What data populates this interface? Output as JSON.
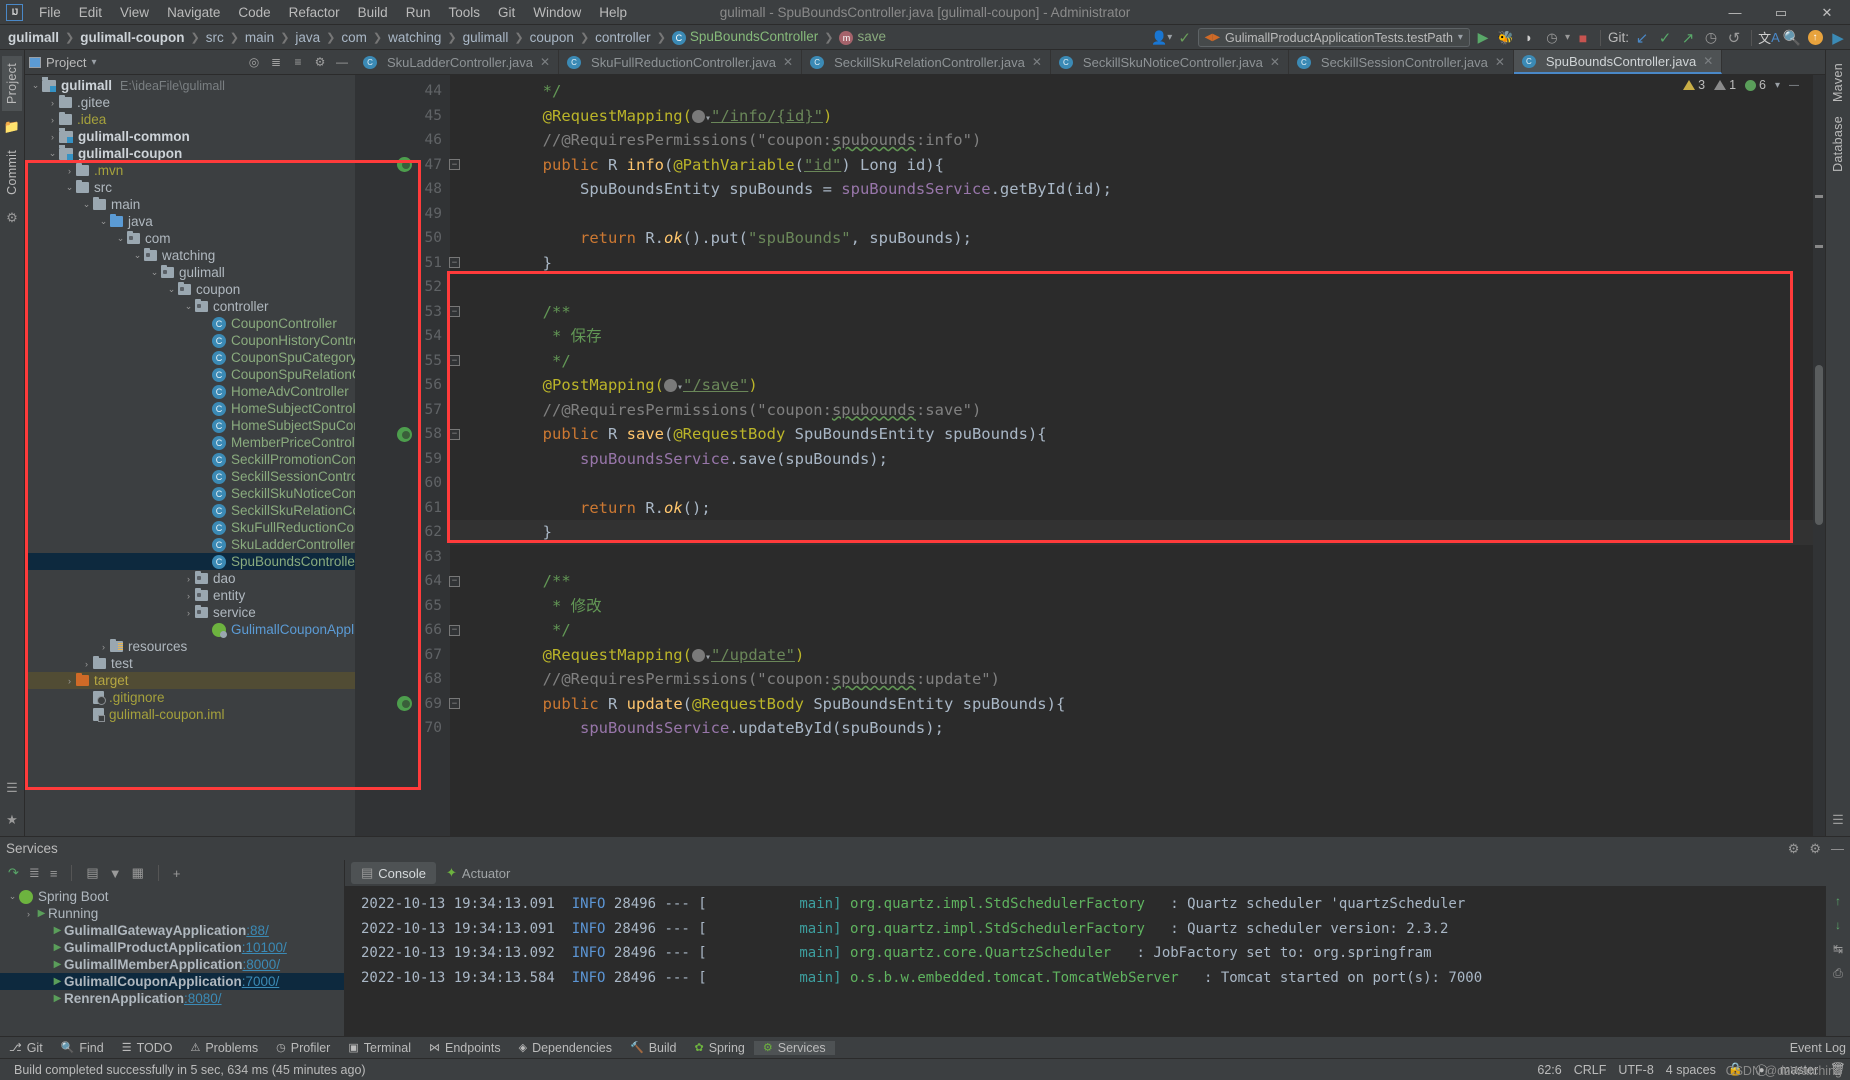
{
  "window": {
    "title": "gulimall - SpuBoundsController.java [gulimall-coupon] - Administrator",
    "minimize": "—",
    "maximize": "▭",
    "close": "✕"
  },
  "menu": [
    "File",
    "Edit",
    "View",
    "Navigate",
    "Code",
    "Refactor",
    "Build",
    "Run",
    "Tools",
    "Git",
    "Window",
    "Help"
  ],
  "breadcrumbs": [
    "gulimall",
    "gulimall-coupon",
    "src",
    "main",
    "java",
    "com",
    "watching",
    "gulimall",
    "coupon",
    "controller",
    "SpuBoundsController",
    "save"
  ],
  "toolbar": {
    "run_config": "GulimallProductApplicationTests.testPath",
    "git_label": "Git:",
    "icons": [
      "profile-icon",
      "hammer-icon",
      "run-icon",
      "debug-icon",
      "run-coverage-icon",
      "profiler-icon",
      "stop-icon",
      "git-update-icon",
      "git-commit-icon",
      "git-push-icon",
      "git-history-icon",
      "git-rollback-icon",
      "translate-icon",
      "search-everywhere-icon",
      "update-icon",
      "ide-icon"
    ]
  },
  "left_strip": {
    "tabs": [
      "Project",
      "Commit"
    ],
    "icons": [
      "folder-icon",
      "commit-icon"
    ]
  },
  "right_strip": {
    "tabs": [
      "Maven",
      "Database"
    ],
    "icons": [
      "notification-icon"
    ]
  },
  "project_panel": {
    "title": "Project",
    "header_icons": [
      "locate-icon",
      "expand-all-icon",
      "collapse-all-icon",
      "gear-icon",
      "hide-icon"
    ],
    "tree": [
      {
        "indent": 0,
        "arrow": "⌄",
        "icon": "module",
        "label": "gulimall",
        "style": "b",
        "path": "E:\\ideaFile\\gulimall"
      },
      {
        "indent": 1,
        "arrow": "›",
        "icon": "folder",
        "label": ".gitee",
        "style": ""
      },
      {
        "indent": 1,
        "arrow": "›",
        "icon": "folder",
        "label": ".idea",
        "style": "olive"
      },
      {
        "indent": 1,
        "arrow": "›",
        "icon": "module",
        "label": "gulimall-common",
        "style": "b"
      },
      {
        "indent": 1,
        "arrow": "⌄",
        "icon": "module",
        "label": "gulimall-coupon",
        "style": "b"
      },
      {
        "indent": 2,
        "arrow": "›",
        "icon": "folder",
        "label": ".mvn",
        "style": "olive"
      },
      {
        "indent": 2,
        "arrow": "⌄",
        "icon": "folder",
        "label": "src",
        "style": ""
      },
      {
        "indent": 3,
        "arrow": "⌄",
        "icon": "folder",
        "label": "main",
        "style": ""
      },
      {
        "indent": 4,
        "arrow": "⌄",
        "icon": "src",
        "label": "java",
        "style": ""
      },
      {
        "indent": 5,
        "arrow": "⌄",
        "icon": "pkg",
        "label": "com",
        "style": ""
      },
      {
        "indent": 6,
        "arrow": "⌄",
        "icon": "pkg",
        "label": "watching",
        "style": ""
      },
      {
        "indent": 7,
        "arrow": "⌄",
        "icon": "pkg",
        "label": "gulimall",
        "style": ""
      },
      {
        "indent": 8,
        "arrow": "⌄",
        "icon": "pkg",
        "label": "coupon",
        "style": ""
      },
      {
        "indent": 9,
        "arrow": "⌄",
        "icon": "pkg",
        "label": "controller",
        "style": ""
      },
      {
        "indent": 10,
        "arrow": "",
        "icon": "class",
        "label": "CouponController",
        "style": "green"
      },
      {
        "indent": 10,
        "arrow": "",
        "icon": "class",
        "label": "CouponHistoryController",
        "style": "green"
      },
      {
        "indent": 10,
        "arrow": "",
        "icon": "class",
        "label": "CouponSpuCategoryRelationC",
        "style": "green"
      },
      {
        "indent": 10,
        "arrow": "",
        "icon": "class",
        "label": "CouponSpuRelationController",
        "style": "green"
      },
      {
        "indent": 10,
        "arrow": "",
        "icon": "class",
        "label": "HomeAdvController",
        "style": "green"
      },
      {
        "indent": 10,
        "arrow": "",
        "icon": "class",
        "label": "HomeSubjectController",
        "style": "green"
      },
      {
        "indent": 10,
        "arrow": "",
        "icon": "class",
        "label": "HomeSubjectSpuController",
        "style": "green"
      },
      {
        "indent": 10,
        "arrow": "",
        "icon": "class",
        "label": "MemberPriceController",
        "style": "green"
      },
      {
        "indent": 10,
        "arrow": "",
        "icon": "class",
        "label": "SeckillPromotionController",
        "style": "green"
      },
      {
        "indent": 10,
        "arrow": "",
        "icon": "class",
        "label": "SeckillSessionController",
        "style": "green"
      },
      {
        "indent": 10,
        "arrow": "",
        "icon": "class",
        "label": "SeckillSkuNoticeController",
        "style": "green"
      },
      {
        "indent": 10,
        "arrow": "",
        "icon": "class",
        "label": "SeckillSkuRelationController",
        "style": "green"
      },
      {
        "indent": 10,
        "arrow": "",
        "icon": "class",
        "label": "SkuFullReductionController",
        "style": "green"
      },
      {
        "indent": 10,
        "arrow": "",
        "icon": "class",
        "label": "SkuLadderController",
        "style": "green"
      },
      {
        "indent": 10,
        "arrow": "",
        "icon": "class",
        "label": "SpuBoundsController",
        "style": "green",
        "selected": true
      },
      {
        "indent": 9,
        "arrow": "›",
        "icon": "pkg",
        "label": "dao",
        "style": ""
      },
      {
        "indent": 9,
        "arrow": "›",
        "icon": "pkg",
        "label": "entity",
        "style": ""
      },
      {
        "indent": 9,
        "arrow": "›",
        "icon": "pkg",
        "label": "service",
        "style": ""
      },
      {
        "indent": 10,
        "arrow": "",
        "icon": "spring",
        "label": "GulimallCouponApplication",
        "style": "blue"
      },
      {
        "indent": 4,
        "arrow": "›",
        "icon": "res",
        "label": "resources",
        "style": ""
      },
      {
        "indent": 3,
        "arrow": "›",
        "icon": "folder",
        "label": "test",
        "style": ""
      },
      {
        "indent": 2,
        "arrow": "›",
        "icon": "orange",
        "label": "target",
        "style": "yellow",
        "highlight": true
      },
      {
        "indent": 3,
        "arrow": "",
        "icon": "ignore",
        "label": ".gitignore",
        "style": "olive"
      },
      {
        "indent": 3,
        "arrow": "",
        "icon": "iml",
        "label": "gulimall-coupon.iml",
        "style": "olive"
      }
    ]
  },
  "editor": {
    "tabs": [
      {
        "label": "SkuLadderController.java",
        "active": false
      },
      {
        "label": "SkuFullReductionController.java",
        "active": false
      },
      {
        "label": "SeckillSkuRelationController.java",
        "active": false
      },
      {
        "label": "SeckillSkuNoticeController.java",
        "active": false
      },
      {
        "label": "SeckillSessionController.java",
        "active": false
      },
      {
        "label": "SpuBoundsController.java",
        "active": true
      }
    ],
    "inspections": {
      "warnings": "3",
      "weak_warnings": "1",
      "typos": "6"
    },
    "lines": [
      {
        "n": "44",
        "html": "        <span class='doc'>*/</span>"
      },
      {
        "n": "45",
        "html": "        <span class='ann'>@RequestMapping(</span><span class='globe-wrap'></span><span class='str ul'>\"/info/{id}\"</span><span class='ann'>)</span>"
      },
      {
        "n": "46",
        "html": "        <span class='cmt'>//@RequiresPermissions(\"coupon:<span class='wavy'>spubounds</span>:info\")</span>"
      },
      {
        "n": "47",
        "html": "        <span class='kw'>public</span> R <span class='fn'>info</span>(<span class='ann'>@PathVariable</span>(<span class='str ul'>\"id\"</span>) Long id){",
        "marker": true,
        "fold": true
      },
      {
        "n": "48",
        "html": "            SpuBoundsEntity spuBounds = <span class='fld'>spuBoundsService</span>.getById(id);"
      },
      {
        "n": "49",
        "html": ""
      },
      {
        "n": "50",
        "html": "            <span class='kw'>return</span> R.<span class='fn' style='font-style:italic'>ok</span>().put(<span class='str'>\"spuBounds\"</span>, spuBounds);"
      },
      {
        "n": "51",
        "html": "        }",
        "fold": true
      },
      {
        "n": "52",
        "html": ""
      },
      {
        "n": "53",
        "html": "        <span class='doc'>/**</span>",
        "fold": true
      },
      {
        "n": "54",
        "html": "        <span class='doc'> * 保存</span>"
      },
      {
        "n": "55",
        "html": "        <span class='doc'> */</span>",
        "fold": true
      },
      {
        "n": "56",
        "html": "        <span class='ann'>@PostMapping(</span><span class='globe-wrap'></span><span class='str ul'>\"/save\"</span><span class='ann'>)</span>"
      },
      {
        "n": "57",
        "html": "        <span class='cmt'>//@RequiresPermissions(\"coupon:<span class='wavy'>spubounds</span>:save\")</span>"
      },
      {
        "n": "58",
        "html": "        <span class='kw'>public</span> R <span class='fn'>save</span>(<span class='ann'>@RequestBody</span> SpuBoundsEntity spuBounds){",
        "marker": true,
        "fold": true
      },
      {
        "n": "59",
        "html": "            <span class='fld'>spuBoundsService</span>.save(spuBounds);"
      },
      {
        "n": "60",
        "html": ""
      },
      {
        "n": "61",
        "html": "            <span class='kw'>return</span> R.<span class='fn' style='font-style:italic'>ok</span>();"
      },
      {
        "n": "62",
        "html": "        }",
        "fold": true,
        "current": true
      },
      {
        "n": "63",
        "html": ""
      },
      {
        "n": "64",
        "html": "        <span class='doc'>/**</span>",
        "fold": true
      },
      {
        "n": "65",
        "html": "        <span class='doc'> * 修改</span>"
      },
      {
        "n": "66",
        "html": "        <span class='doc'> */</span>",
        "fold": true
      },
      {
        "n": "67",
        "html": "        <span class='ann'>@RequestMapping(</span><span class='globe-wrap'></span><span class='str ul'>\"/update\"</span><span class='ann'>)</span>"
      },
      {
        "n": "68",
        "html": "        <span class='cmt'>//@RequiresPermissions(\"coupon:<span class='wavy'>spubounds</span>:update\")</span>"
      },
      {
        "n": "69",
        "html": "        <span class='kw'>public</span> R <span class='fn'>update</span>(<span class='ann'>@RequestBody</span> SpuBoundsEntity spuBounds){",
        "marker": true,
        "fold": true
      },
      {
        "n": "70",
        "html": "            <span class='fld'>spuBoundsService</span>.updateById(spuBounds);"
      }
    ]
  },
  "services": {
    "panel_title": "Services",
    "toolbar_icons": [
      "rerun-icon",
      "expand-all-icon",
      "collapse-all-icon",
      "group-icon",
      "filter-icon",
      "settings-icon",
      "add-icon"
    ],
    "tree": [
      {
        "indent": 0,
        "arrow": "⌄",
        "icon": "spring",
        "label": "Spring Boot",
        "style": ""
      },
      {
        "indent": 1,
        "arrow": "›",
        "icon": "run",
        "label": "Running",
        "style": ""
      },
      {
        "indent": 2,
        "arrow": "",
        "icon": "leaf",
        "label": "GulimallGatewayApplication",
        "port": ":88/"
      },
      {
        "indent": 2,
        "arrow": "",
        "icon": "leaf",
        "label": "GulimallProductApplication",
        "port": ":10100/"
      },
      {
        "indent": 2,
        "arrow": "",
        "icon": "leaf",
        "label": "GulimallMemberApplication",
        "port": ":8000/"
      },
      {
        "indent": 2,
        "arrow": "",
        "icon": "leaf",
        "label": "GulimallCouponApplication",
        "port": ":7000/",
        "selected": true
      },
      {
        "indent": 2,
        "arrow": "",
        "icon": "leaf",
        "label": "RenrenApplication",
        "port": ":8080/"
      }
    ],
    "console_tabs": [
      {
        "label": "Console",
        "active": true
      },
      {
        "label": "Actuator",
        "active": false
      }
    ],
    "log": [
      {
        "ts": "2022-10-13 19:34:13.091",
        "level": "INFO",
        "pid": "28496",
        "dash": "--- [",
        "thread": "           main]",
        "cls": "org.quartz.impl.StdSchedulerFactory",
        "msg": ": Quartz scheduler 'quartzScheduler"
      },
      {
        "ts": "2022-10-13 19:34:13.091",
        "level": "INFO",
        "pid": "28496",
        "dash": "--- [",
        "thread": "           main]",
        "cls": "org.quartz.impl.StdSchedulerFactory",
        "msg": ": Quartz scheduler version: 2.3.2"
      },
      {
        "ts": "2022-10-13 19:34:13.092",
        "level": "INFO",
        "pid": "28496",
        "dash": "--- [",
        "thread": "           main]",
        "cls": "org.quartz.core.QuartzScheduler",
        "msg": ": JobFactory set to: org.springfram"
      },
      {
        "ts": "2022-10-13 19:34:13.584",
        "level": "INFO",
        "pid": "28496",
        "dash": "--- [",
        "thread": "           main]",
        "cls": "o.s.b.w.embedded.tomcat.TomcatWebServer",
        "msg": ": Tomcat started on port(s): 7000 "
      }
    ]
  },
  "tool_row": [
    {
      "label": "Git",
      "icon": "git-icon"
    },
    {
      "label": "Find",
      "icon": "search-icon"
    },
    {
      "label": "TODO",
      "icon": "todo-icon"
    },
    {
      "label": "Problems",
      "icon": "problems-icon"
    },
    {
      "label": "Profiler",
      "icon": "profiler-icon"
    },
    {
      "label": "Terminal",
      "icon": "terminal-icon"
    },
    {
      "label": "Endpoints",
      "icon": "endpoints-icon"
    },
    {
      "label": "Dependencies",
      "icon": "dependencies-icon"
    },
    {
      "label": "Build",
      "icon": "build-icon"
    },
    {
      "label": "Spring",
      "icon": "spring-icon"
    },
    {
      "label": "Services",
      "icon": "services-icon",
      "active": true
    }
  ],
  "status_bar": {
    "message": "Build completed successfully in 5 sec, 634 ms (45 minutes ago)",
    "caret": "62:6",
    "line_sep": "CRLF",
    "encoding": "UTF-8",
    "indent": "4 spaces",
    "branch": "master",
    "event_log": "Event Log",
    "lock": "lock-icon"
  },
  "watermark": "CSDN @dzWatching",
  "bottom_strip": {
    "tabs": [
      "Structure",
      "Bookmarks"
    ]
  }
}
